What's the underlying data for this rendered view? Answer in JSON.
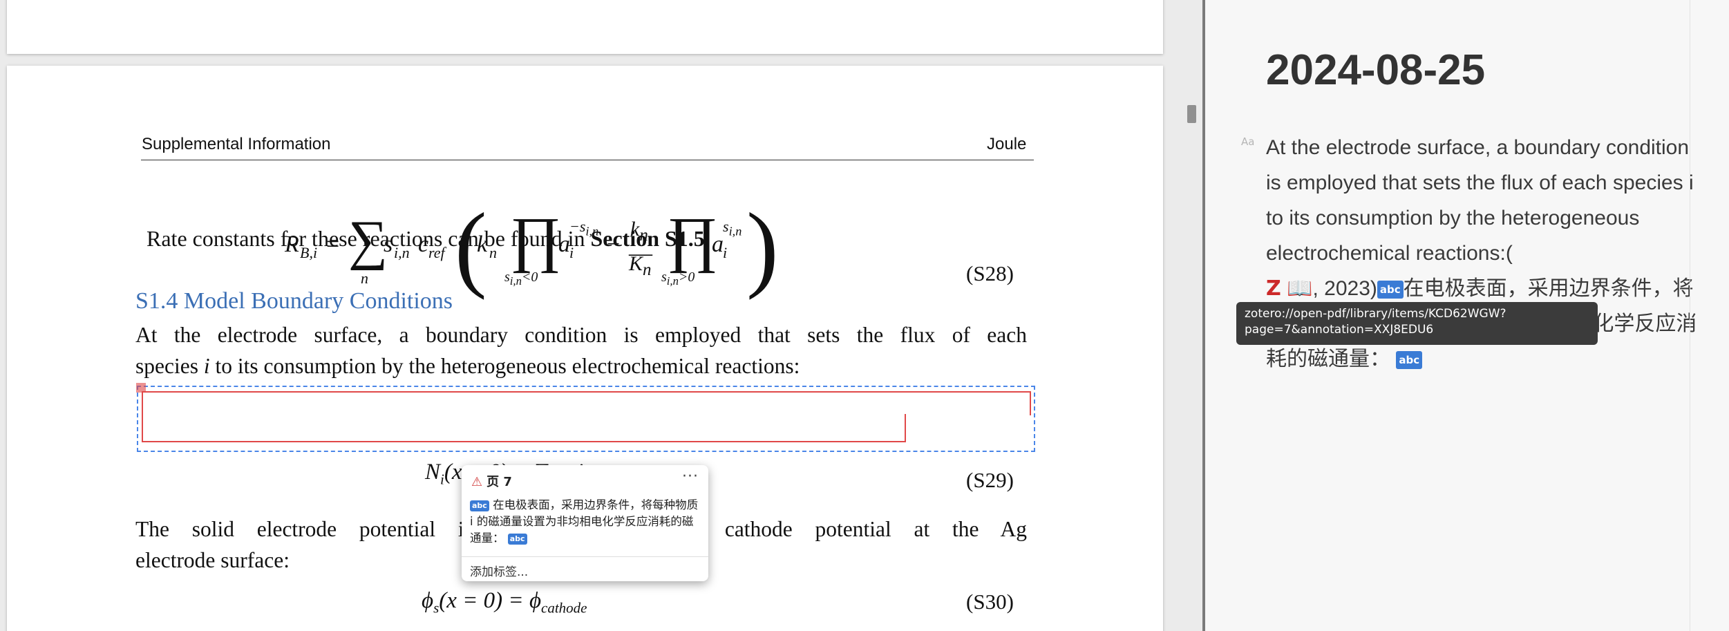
{
  "pdf": {
    "header_left": "Supplemental Information",
    "header_right": "Joule",
    "eq28_number": "(S28)",
    "rate_text": "Rate constants for these reactions can be found in ",
    "rate_bold": "Section S1.5",
    "rate_end": ".",
    "section_title": "S1.4 Model Boundary Conditions",
    "para1_line1": "At the electrode surface, a boundary condition is employed that sets the flux of each",
    "para1_line2_pre": "species ",
    "para1_line2_i": "i",
    "para1_line2_post": " to its consumption by the heterogeneous electrochemical reactions:",
    "eq29_number": "(S29)",
    "para2_line1": "The solid electrode potential is set to the nominal cathode potential at the Ag",
    "para2_line2": "electrode surface:",
    "eq30_number": "(S30)"
  },
  "popup": {
    "page_label": "页 7",
    "more": "···",
    "body": "在电极表面，采用边界条件，将每种物质 i 的磁通量设置为非均相电化学反应消耗的磁通量：",
    "add_tag": "添加标签..."
  },
  "note": {
    "date": "2024-08-25",
    "aa": "Aa",
    "text": "At the electrode surface, a boundary condition is employed that sets the flux of each species i to its consumption by the heterogeneous electrochemical reactions:(",
    "cite_year": ", 2023)",
    "translation": "在电极表面，采用边界条件，将每种物质 i 的磁通量设置为非均相电化学反应消耗的磁通量：",
    "abc": "abc",
    "z": "Z",
    "tooltip": "zotero://open-pdf/library/items/KCD62WGW?page=7&annotation=XXJ8EDU6"
  }
}
